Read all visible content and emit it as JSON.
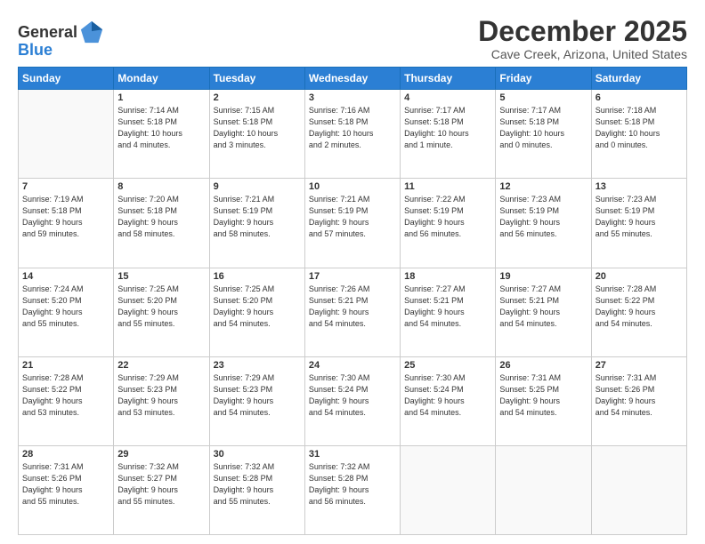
{
  "header": {
    "logo_line1": "General",
    "logo_line2": "Blue",
    "month": "December 2025",
    "location": "Cave Creek, Arizona, United States"
  },
  "days_of_week": [
    "Sunday",
    "Monday",
    "Tuesday",
    "Wednesday",
    "Thursday",
    "Friday",
    "Saturday"
  ],
  "weeks": [
    [
      {
        "day": "",
        "info": ""
      },
      {
        "day": "1",
        "info": "Sunrise: 7:14 AM\nSunset: 5:18 PM\nDaylight: 10 hours\nand 4 minutes."
      },
      {
        "day": "2",
        "info": "Sunrise: 7:15 AM\nSunset: 5:18 PM\nDaylight: 10 hours\nand 3 minutes."
      },
      {
        "day": "3",
        "info": "Sunrise: 7:16 AM\nSunset: 5:18 PM\nDaylight: 10 hours\nand 2 minutes."
      },
      {
        "day": "4",
        "info": "Sunrise: 7:17 AM\nSunset: 5:18 PM\nDaylight: 10 hours\nand 1 minute."
      },
      {
        "day": "5",
        "info": "Sunrise: 7:17 AM\nSunset: 5:18 PM\nDaylight: 10 hours\nand 0 minutes."
      },
      {
        "day": "6",
        "info": "Sunrise: 7:18 AM\nSunset: 5:18 PM\nDaylight: 10 hours\nand 0 minutes."
      }
    ],
    [
      {
        "day": "7",
        "info": "Sunrise: 7:19 AM\nSunset: 5:18 PM\nDaylight: 9 hours\nand 59 minutes."
      },
      {
        "day": "8",
        "info": "Sunrise: 7:20 AM\nSunset: 5:18 PM\nDaylight: 9 hours\nand 58 minutes."
      },
      {
        "day": "9",
        "info": "Sunrise: 7:21 AM\nSunset: 5:19 PM\nDaylight: 9 hours\nand 58 minutes."
      },
      {
        "day": "10",
        "info": "Sunrise: 7:21 AM\nSunset: 5:19 PM\nDaylight: 9 hours\nand 57 minutes."
      },
      {
        "day": "11",
        "info": "Sunrise: 7:22 AM\nSunset: 5:19 PM\nDaylight: 9 hours\nand 56 minutes."
      },
      {
        "day": "12",
        "info": "Sunrise: 7:23 AM\nSunset: 5:19 PM\nDaylight: 9 hours\nand 56 minutes."
      },
      {
        "day": "13",
        "info": "Sunrise: 7:23 AM\nSunset: 5:19 PM\nDaylight: 9 hours\nand 55 minutes."
      }
    ],
    [
      {
        "day": "14",
        "info": "Sunrise: 7:24 AM\nSunset: 5:20 PM\nDaylight: 9 hours\nand 55 minutes."
      },
      {
        "day": "15",
        "info": "Sunrise: 7:25 AM\nSunset: 5:20 PM\nDaylight: 9 hours\nand 55 minutes."
      },
      {
        "day": "16",
        "info": "Sunrise: 7:25 AM\nSunset: 5:20 PM\nDaylight: 9 hours\nand 54 minutes."
      },
      {
        "day": "17",
        "info": "Sunrise: 7:26 AM\nSunset: 5:21 PM\nDaylight: 9 hours\nand 54 minutes."
      },
      {
        "day": "18",
        "info": "Sunrise: 7:27 AM\nSunset: 5:21 PM\nDaylight: 9 hours\nand 54 minutes."
      },
      {
        "day": "19",
        "info": "Sunrise: 7:27 AM\nSunset: 5:21 PM\nDaylight: 9 hours\nand 54 minutes."
      },
      {
        "day": "20",
        "info": "Sunrise: 7:28 AM\nSunset: 5:22 PM\nDaylight: 9 hours\nand 54 minutes."
      }
    ],
    [
      {
        "day": "21",
        "info": "Sunrise: 7:28 AM\nSunset: 5:22 PM\nDaylight: 9 hours\nand 53 minutes."
      },
      {
        "day": "22",
        "info": "Sunrise: 7:29 AM\nSunset: 5:23 PM\nDaylight: 9 hours\nand 53 minutes."
      },
      {
        "day": "23",
        "info": "Sunrise: 7:29 AM\nSunset: 5:23 PM\nDaylight: 9 hours\nand 54 minutes."
      },
      {
        "day": "24",
        "info": "Sunrise: 7:30 AM\nSunset: 5:24 PM\nDaylight: 9 hours\nand 54 minutes."
      },
      {
        "day": "25",
        "info": "Sunrise: 7:30 AM\nSunset: 5:24 PM\nDaylight: 9 hours\nand 54 minutes."
      },
      {
        "day": "26",
        "info": "Sunrise: 7:31 AM\nSunset: 5:25 PM\nDaylight: 9 hours\nand 54 minutes."
      },
      {
        "day": "27",
        "info": "Sunrise: 7:31 AM\nSunset: 5:26 PM\nDaylight: 9 hours\nand 54 minutes."
      }
    ],
    [
      {
        "day": "28",
        "info": "Sunrise: 7:31 AM\nSunset: 5:26 PM\nDaylight: 9 hours\nand 55 minutes."
      },
      {
        "day": "29",
        "info": "Sunrise: 7:32 AM\nSunset: 5:27 PM\nDaylight: 9 hours\nand 55 minutes."
      },
      {
        "day": "30",
        "info": "Sunrise: 7:32 AM\nSunset: 5:28 PM\nDaylight: 9 hours\nand 55 minutes."
      },
      {
        "day": "31",
        "info": "Sunrise: 7:32 AM\nSunset: 5:28 PM\nDaylight: 9 hours\nand 56 minutes."
      },
      {
        "day": "",
        "info": ""
      },
      {
        "day": "",
        "info": ""
      },
      {
        "day": "",
        "info": ""
      }
    ]
  ]
}
